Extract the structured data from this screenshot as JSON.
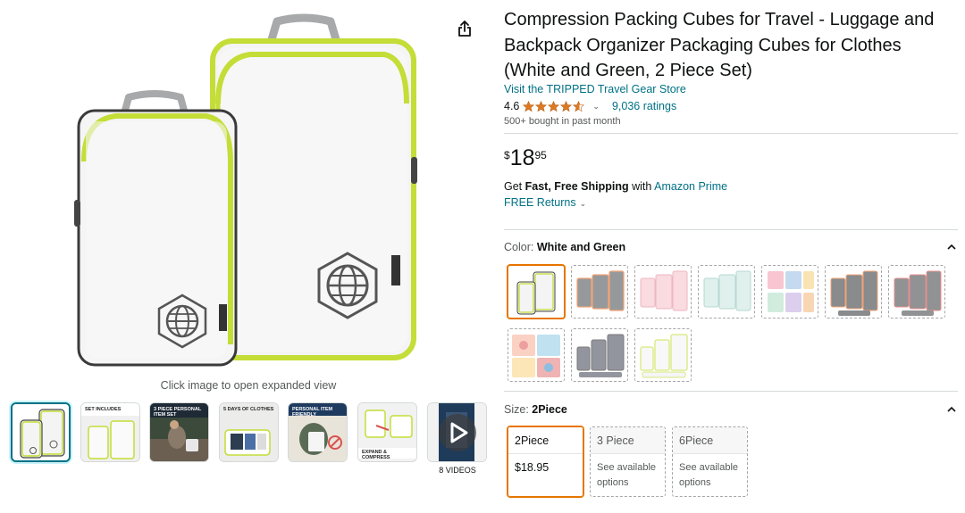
{
  "gallery": {
    "click_hint": "Click image to open expanded view",
    "videos_label": "8 VIDEOS",
    "main_image_icon": "packing-cubes-image",
    "thumbnails": [
      {
        "icon": "packing-cubes-thumbnail",
        "label": ""
      },
      {
        "icon": "set-includes-thumbnail",
        "label": "SET INCLUDES"
      },
      {
        "icon": "personal-item-set-thumbnail",
        "label": "3 PIECE PERSONAL ITEM SET"
      },
      {
        "icon": "five-days-clothes-thumbnail",
        "label": "5 DAYS OF CLOTHES"
      },
      {
        "icon": "personal-item-friendly-thumbnail",
        "label": "PERSONAL ITEM FRIENDLY"
      },
      {
        "icon": "expand-compress-thumbnail",
        "label": "EXPAND & COMPRESS"
      },
      {
        "icon": "video-play-thumbnail",
        "label": ""
      }
    ]
  },
  "product": {
    "title": "Compression Packing Cubes for Travel - Luggage and Backpack Organizer Packaging Cubes for Clothes (White and Green, 2 Piece Set)",
    "store_link": "Visit the TRIPPED Travel Gear Store",
    "rating_value": "4.6",
    "rating_stars": 4.6,
    "ratings_count": "9,036 ratings",
    "bought_text": "500+ bought in past month",
    "price": {
      "symbol": "$",
      "whole": "18",
      "fraction": "95"
    },
    "shipping": {
      "prefix": "Get ",
      "bold": "Fast, Free Shipping",
      "middle": " with ",
      "link": "Amazon Prime"
    },
    "returns": "FREE Returns"
  },
  "color": {
    "label": "Color: ",
    "value": "White and Green",
    "swatches": [
      {
        "name": "White and Green",
        "selected": true
      },
      {
        "name": "Orange Grey",
        "selected": false
      },
      {
        "name": "Pink",
        "selected": false
      },
      {
        "name": "Mint",
        "selected": false
      },
      {
        "name": "Colorful",
        "selected": false
      },
      {
        "name": "Grey Orange",
        "selected": false
      },
      {
        "name": "Grey Red",
        "selected": false
      },
      {
        "name": "Printed",
        "selected": false
      },
      {
        "name": "Dark Grey",
        "selected": false
      },
      {
        "name": "Light Green",
        "selected": false
      }
    ]
  },
  "size": {
    "label": "Size: ",
    "value": "2Piece",
    "options": [
      {
        "name": "2Piece",
        "price": "$18.95",
        "selected": true
      },
      {
        "name": "3 Piece",
        "availability": "See available options",
        "selected": false
      },
      {
        "name": "6Piece",
        "availability": "See available options",
        "selected": false
      }
    ]
  },
  "colors": {
    "link": "#007185",
    "star": "#de7921",
    "accent_green": "#b7d333",
    "selected_border": "#e77600"
  }
}
